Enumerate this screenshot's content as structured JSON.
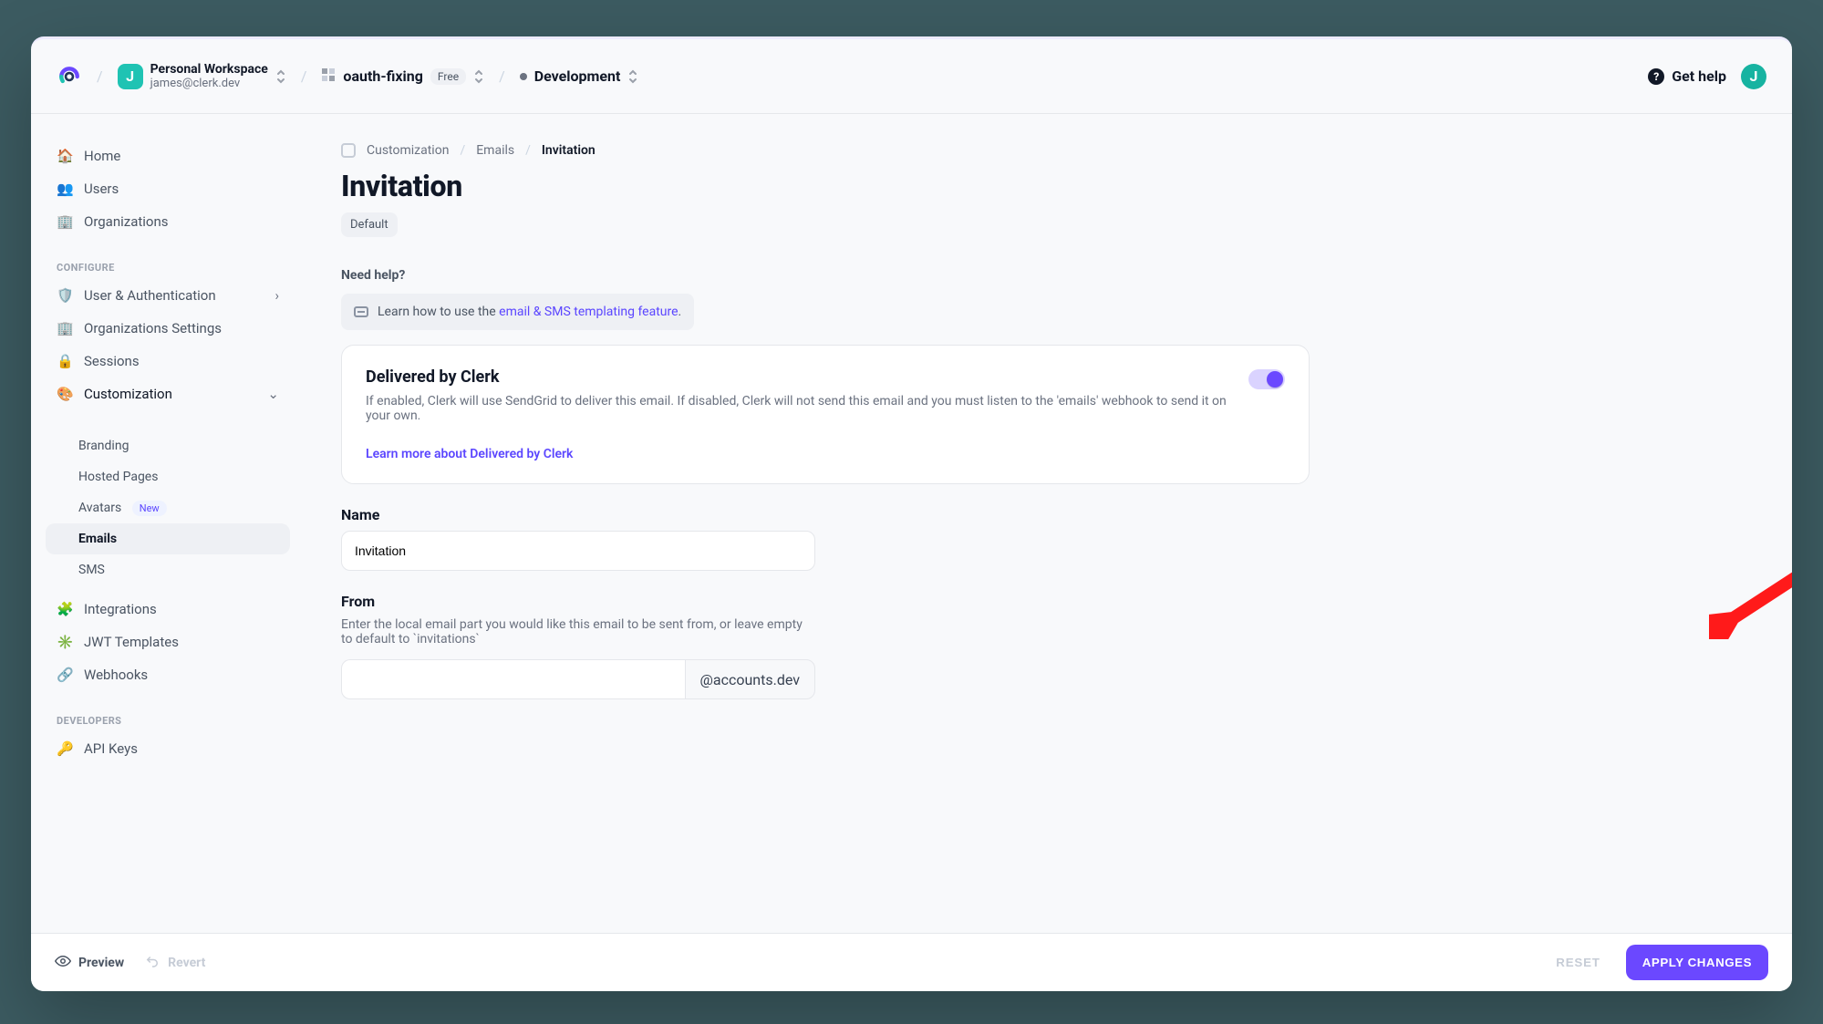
{
  "header": {
    "workspace_initial": "J",
    "workspace_name": "Personal Workspace",
    "workspace_email": "james@clerk.dev",
    "project_name": "oauth-fixing",
    "project_plan": "Free",
    "environment": "Development",
    "help_label": "Get help",
    "avatar_initial": "J"
  },
  "sidebar": {
    "main": [
      {
        "label": "Home"
      },
      {
        "label": "Users"
      },
      {
        "label": "Organizations"
      }
    ],
    "configure_title": "CONFIGURE",
    "configure": [
      {
        "label": "User & Authentication"
      },
      {
        "label": "Organizations Settings"
      },
      {
        "label": "Sessions"
      },
      {
        "label": "Customization"
      }
    ],
    "customization_children": [
      {
        "label": "Branding"
      },
      {
        "label": "Hosted Pages"
      },
      {
        "label": "Avatars",
        "badge": "New"
      },
      {
        "label": "Emails",
        "active": true
      },
      {
        "label": "SMS"
      }
    ],
    "more": [
      {
        "label": "Integrations"
      },
      {
        "label": "JWT Templates"
      },
      {
        "label": "Webhooks"
      }
    ],
    "developers_title": "DEVELOPERS",
    "developers": [
      {
        "label": "API Keys"
      }
    ]
  },
  "breadcrumbs": {
    "a": "Customization",
    "b": "Emails",
    "c": "Invitation"
  },
  "page": {
    "title": "Invitation",
    "badge": "Default",
    "need_help": "Need help?",
    "help_text_prefix": "Learn how to use the ",
    "help_link": "email & SMS templating feature",
    "panel_title": "Delivered by Clerk",
    "panel_desc": "If enabled, Clerk will use SendGrid to deliver this email. If disabled, Clerk will not send this email and you must listen to the 'emails' webhook to send it on your own.",
    "panel_learn": "Learn more about Delivered by Clerk",
    "name_label": "Name",
    "name_value": "Invitation",
    "from_label": "From",
    "from_help": "Enter the local email part you would like this email to be sent from, or leave empty to default to `invitations`",
    "from_addon": "@accounts.dev"
  },
  "footer": {
    "preview": "Preview",
    "revert": "Revert",
    "reset": "RESET",
    "apply": "APPLY CHANGES"
  }
}
